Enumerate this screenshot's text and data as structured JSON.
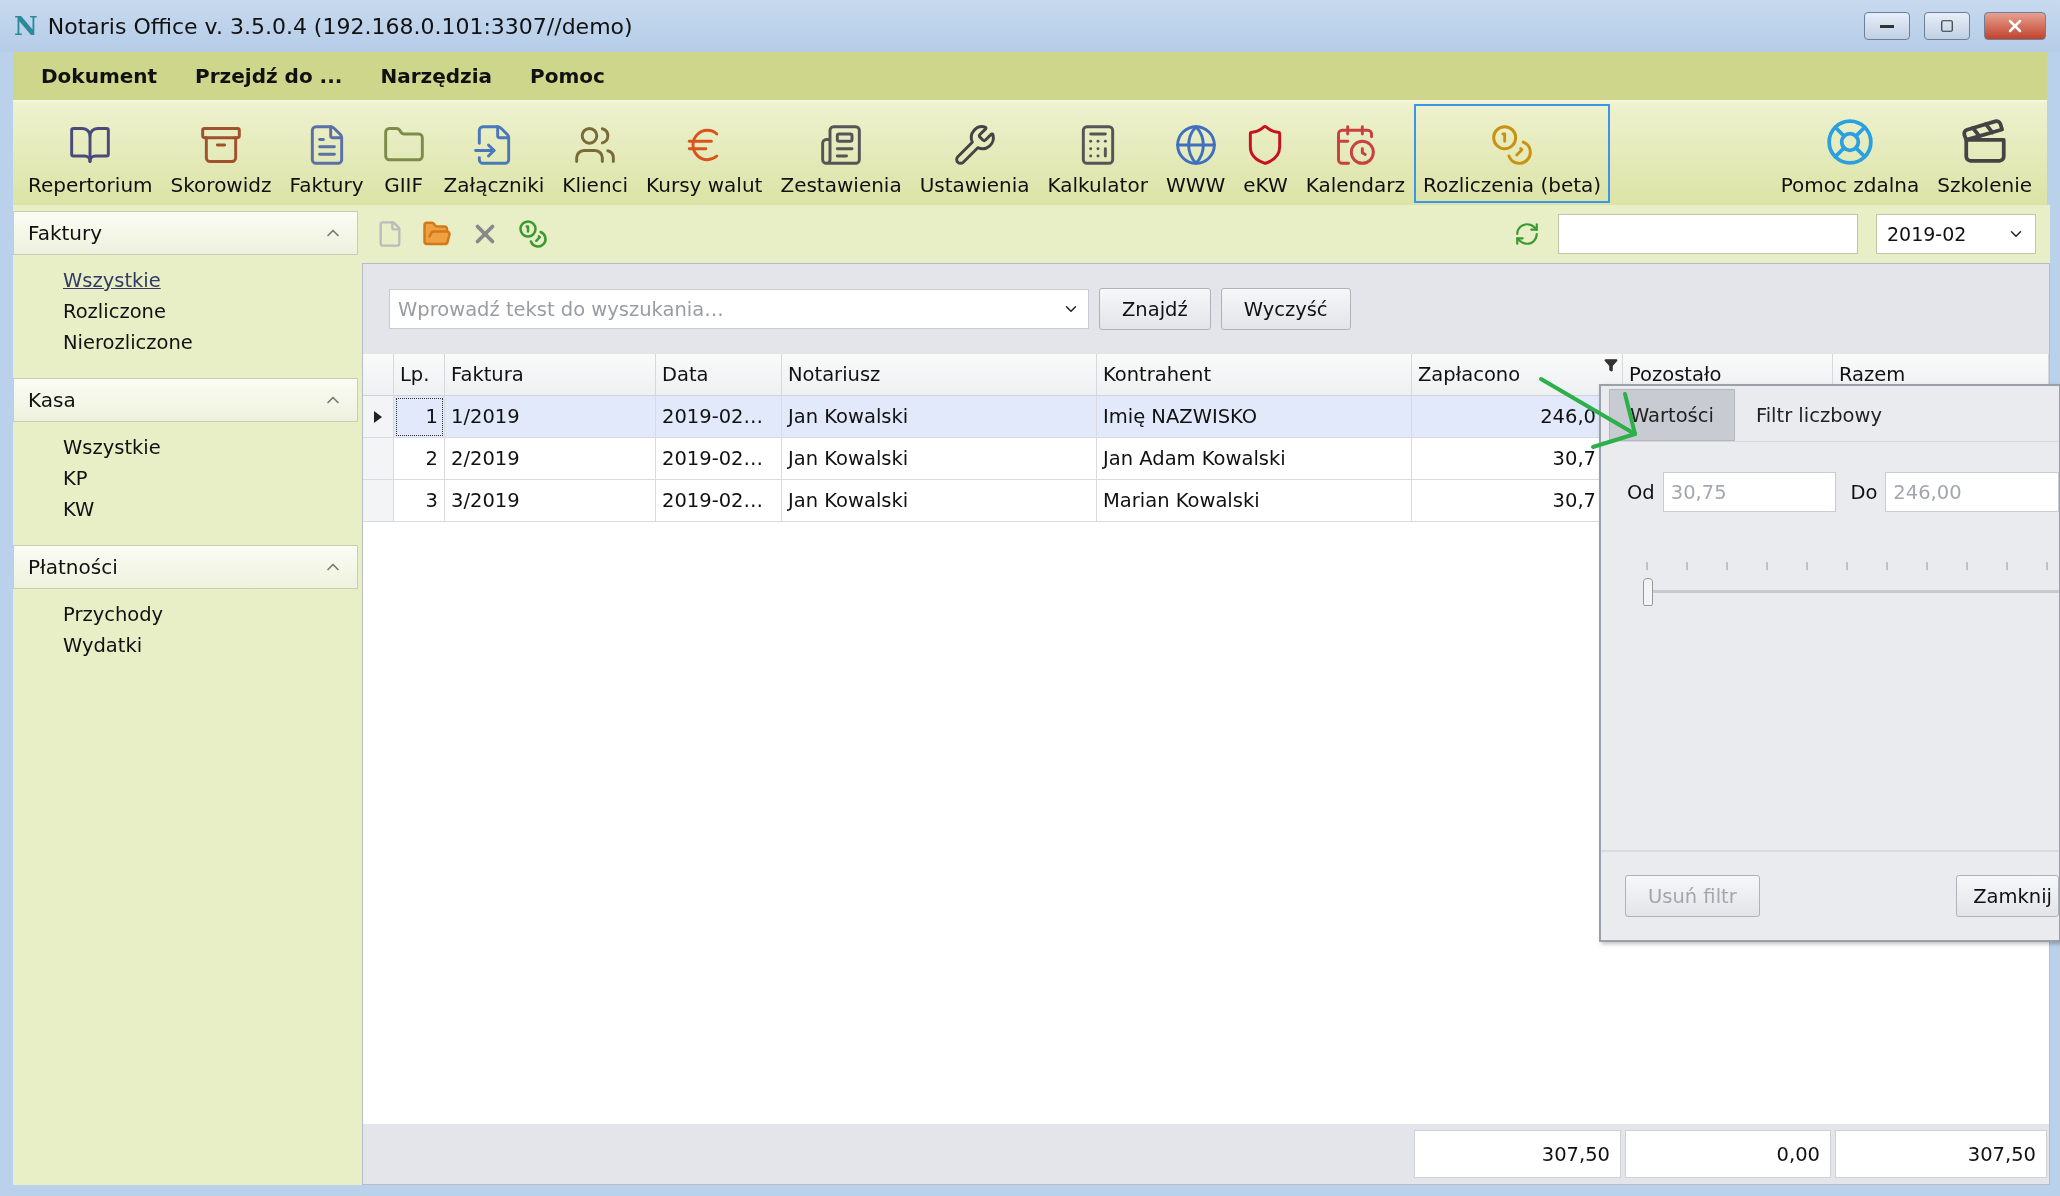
{
  "window": {
    "logo": "N",
    "title": "Notaris Office v. 3.5.0.4 (192.168.0.101:3307//demo)"
  },
  "menu": [
    "Dokument",
    "Przejdź do ...",
    "Narzędzia",
    "Pomoc"
  ],
  "toolbar": {
    "items": [
      {
        "label": "Repertorium",
        "selected": false
      },
      {
        "label": "Skorowidz",
        "selected": false
      },
      {
        "label": "Faktury",
        "selected": false
      },
      {
        "label": "GIIF",
        "selected": false
      },
      {
        "label": "Załączniki",
        "selected": false
      },
      {
        "label": "Klienci",
        "selected": false
      },
      {
        "label": "Kursy walut",
        "selected": false
      },
      {
        "label": "Zestawienia",
        "selected": false
      },
      {
        "label": "Ustawienia",
        "selected": false
      },
      {
        "label": "Kalkulator",
        "selected": false
      },
      {
        "label": "WWW",
        "selected": false
      },
      {
        "label": "eKW",
        "selected": false
      },
      {
        "label": "Kalendarz",
        "selected": false
      },
      {
        "label": "Rozliczenia (beta)",
        "selected": true
      }
    ],
    "right_items": [
      {
        "label": "Pomoc zdalna",
        "selected": false
      },
      {
        "label": "Szkolenie",
        "selected": false
      }
    ]
  },
  "sidebar": {
    "groups": [
      {
        "title": "Faktury",
        "expanded": true,
        "items": [
          {
            "label": "Wszystkie",
            "selected": true
          },
          {
            "label": "Rozliczone",
            "selected": false
          },
          {
            "label": "Nierozliczone",
            "selected": false
          }
        ]
      },
      {
        "title": "Kasa",
        "expanded": true,
        "items": [
          {
            "label": "Wszystkie",
            "selected": false
          },
          {
            "label": "KP",
            "selected": false
          },
          {
            "label": "KW",
            "selected": false
          }
        ]
      },
      {
        "title": "Płatności",
        "expanded": true,
        "items": [
          {
            "label": "Przychody",
            "selected": false
          },
          {
            "label": "Wydatki",
            "selected": false
          }
        ]
      }
    ]
  },
  "action_bar": {
    "period": "2019-02"
  },
  "search": {
    "placeholder": "Wprowadź tekst do wyszukania…",
    "buttons": [
      "Znajdź",
      "Wyczyść"
    ]
  },
  "table": {
    "columns": [
      {
        "label": "Lp.",
        "filtered": false
      },
      {
        "label": "Faktura",
        "filtered": false
      },
      {
        "label": "Data",
        "filtered": false
      },
      {
        "label": "Notariusz",
        "filtered": false
      },
      {
        "label": "Kontrahent",
        "filtered": false
      },
      {
        "label": "Zapłacono",
        "filtered": true
      },
      {
        "label": "Pozostało",
        "filtered": false
      },
      {
        "label": "Razem",
        "filtered": false
      }
    ],
    "rows": [
      {
        "selected": true,
        "cells": [
          "1",
          "1/2019",
          "2019-02…",
          "Jan Kowalski",
          "Imię NAZWISKO",
          "246,0"
        ]
      },
      {
        "selected": false,
        "cells": [
          "2",
          "2/2019",
          "2019-02…",
          "Jan Kowalski",
          "Jan Adam Kowalski",
          "30,7"
        ]
      },
      {
        "selected": false,
        "cells": [
          "3",
          "3/2019",
          "2019-02…",
          "Jan Kowalski",
          "Marian Kowalski",
          "30,7"
        ]
      }
    ],
    "totals": [
      "307,50",
      "0,00",
      "307,50"
    ]
  },
  "filter_popup": {
    "tabs": [
      {
        "label": "Wartości",
        "selected": true
      },
      {
        "label": "Filtr liczbowy",
        "selected": false
      }
    ],
    "from": {
      "label": "Od",
      "placeholder": "30,75"
    },
    "to": {
      "label": "Do",
      "placeholder": "246,00"
    },
    "slider": {
      "level": 0
    },
    "buttons": [
      {
        "label": "Usuń filtr",
        "disabled": true
      },
      {
        "label": "Zamknij",
        "disabled": false
      }
    ]
  }
}
